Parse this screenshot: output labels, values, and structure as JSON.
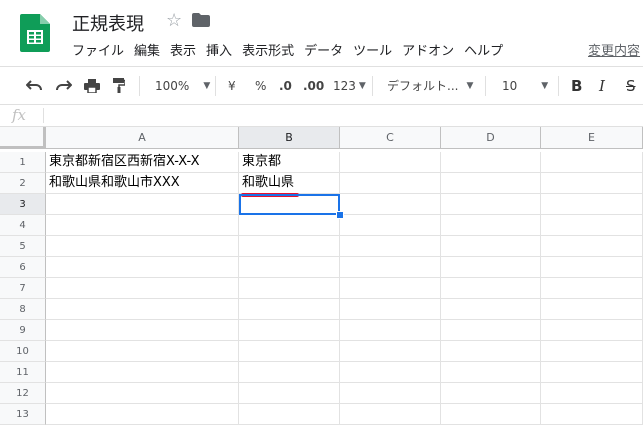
{
  "app": {
    "title": "正規表現",
    "menu": [
      "ファイル",
      "編集",
      "表示",
      "挿入",
      "表示形式",
      "データ",
      "ツール",
      "アドオン",
      "ヘルプ"
    ],
    "changes_link": "変更内容"
  },
  "toolbar": {
    "zoom": "100%",
    "currency": "¥",
    "percent": "%",
    "decrease_decimals": ".0",
    "increase_decimals": ".00",
    "more_formats": "123",
    "font": "デフォルト...",
    "font_size": "10",
    "bold": "B",
    "italic": "I",
    "strike": "S"
  },
  "formula": {
    "fx": "fx",
    "value": ""
  },
  "sheet": {
    "columns": [
      "A",
      "B",
      "C",
      "D",
      "E"
    ],
    "rows": [
      "1",
      "2",
      "3",
      "4",
      "5",
      "6",
      "7",
      "8",
      "9",
      "10",
      "11",
      "12",
      "13"
    ],
    "cells": {
      "A1": "東京都新宿区西新宿X-X-X",
      "B1": "東京都",
      "A2": "和歌山県和歌山市XXX",
      "B2": "和歌山県"
    },
    "selected_cell": "B3"
  },
  "colors": {
    "sheets_green": "#0f9d58",
    "selection_blue": "#1a73e8",
    "annotation_red": "#e8112d"
  }
}
